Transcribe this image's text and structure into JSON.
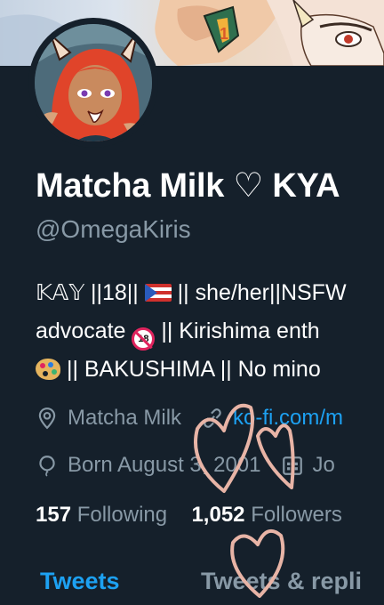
{
  "banner": {
    "badge_number": "1"
  },
  "profile": {
    "display_name": "Matcha Milk",
    "name_heart": "♡",
    "name_suffix": "KYA",
    "handle": "@OmegaKiris"
  },
  "bio": {
    "line1_a": "𝕂𝔸𝕐 ||18|| ",
    "line1_b": " || she/her||NSFW",
    "line2_a": "advocate ",
    "line2_b": " || Kirishima enth",
    "line3_b": " || BAKUSHIMA || No mino"
  },
  "meta": {
    "location": "Matcha Milk",
    "link": "ko-fi.com/m",
    "birthday": "Born August 3, 2001",
    "joined": "Jo"
  },
  "stats": {
    "following_count": "157",
    "following_label": "Following",
    "followers_count": "1,052",
    "followers_label": "Followers"
  },
  "tabs": {
    "tweets": "Tweets",
    "replies": "Tweets & repli"
  },
  "colors": {
    "background": "#15202b",
    "accent": "#1da1f2",
    "secondary_text": "#8899a6",
    "doodle": "#e8b4a6"
  }
}
